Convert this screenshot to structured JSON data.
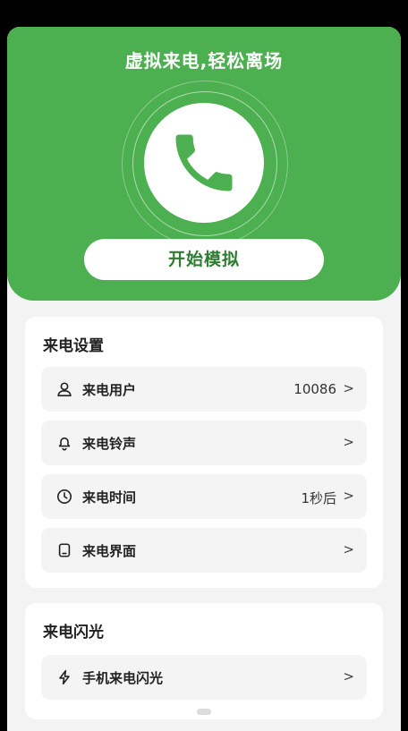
{
  "hero": {
    "title": "虚拟来电,轻松离场",
    "start_button": "开始模拟",
    "colors": {
      "brand": "#4caf50",
      "button_text": "#2e7d32"
    }
  },
  "call_settings": {
    "title": "来电设置",
    "items": [
      {
        "label": "来电用户",
        "value": "10086",
        "icon": "user-icon"
      },
      {
        "label": "来电铃声",
        "value": "",
        "icon": "bell-icon"
      },
      {
        "label": "来电时间",
        "value": "1秒后",
        "icon": "clock-icon"
      },
      {
        "label": "来电界面",
        "value": "",
        "icon": "screen-icon"
      }
    ]
  },
  "flash_settings": {
    "title": "来电闪光",
    "items": [
      {
        "label": "手机来电闪光",
        "value": "",
        "icon": "lightning-icon"
      }
    ]
  },
  "chevron": ">"
}
